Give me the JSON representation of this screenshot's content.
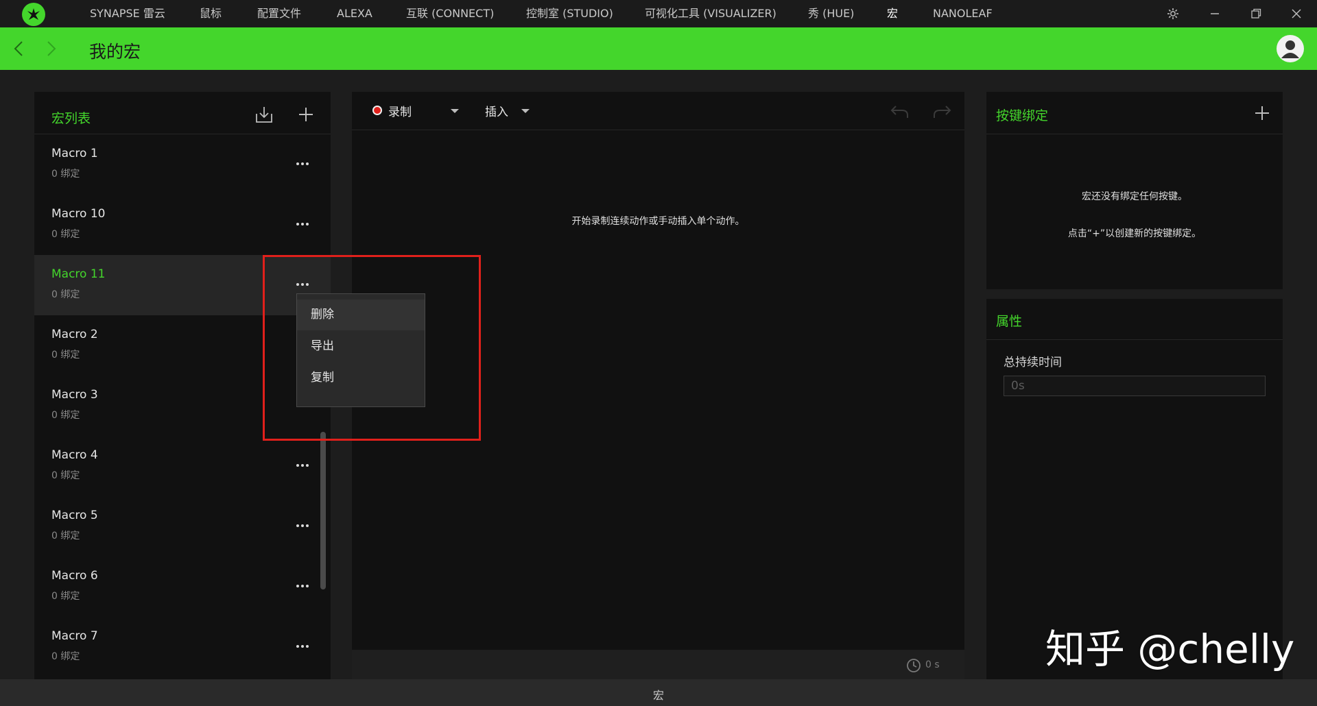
{
  "titlebar": {
    "nav": [
      "SYNAPSE 雷云",
      "鼠标",
      "配置文件",
      "ALEXA",
      "互联 (CONNECT)",
      "控制室 (STUDIO)",
      "可视化工具 (VISUALIZER)",
      "秀 (HUE)",
      "宏",
      "NANOLEAF"
    ],
    "active_index": 8
  },
  "header": {
    "title": "我的宏"
  },
  "macro_list": {
    "title": "宏列表",
    "items": [
      {
        "name": "Macro 1",
        "sub": "0 绑定"
      },
      {
        "name": "Macro 10",
        "sub": "0 绑定"
      },
      {
        "name": "Macro 11",
        "sub": "0 绑定"
      },
      {
        "name": "Macro 2",
        "sub": "0 绑定"
      },
      {
        "name": "Macro 3",
        "sub": "0 绑定"
      },
      {
        "name": "Macro 4",
        "sub": "0 绑定"
      },
      {
        "name": "Macro 5",
        "sub": "0 绑定"
      },
      {
        "name": "Macro 6",
        "sub": "0 绑定"
      },
      {
        "name": "Macro 7",
        "sub": "0 绑定"
      }
    ],
    "selected_index": 2
  },
  "context_menu": {
    "items": [
      "删除",
      "导出",
      "复制"
    ]
  },
  "editor": {
    "record_label": "录制",
    "insert_label": "插入",
    "empty_message": "开始录制连续动作或手动插入单个动作。",
    "duration": "0 s"
  },
  "key_binding": {
    "title": "按键绑定",
    "empty_line1": "宏还没有绑定任何按键。",
    "empty_line2": "点击“+”以创建新的按键绑定。"
  },
  "properties": {
    "title": "属性",
    "total_duration_label": "总持续时间",
    "total_duration_placeholder": "0s"
  },
  "statusbar": {
    "label": "宏"
  },
  "watermark": "知乎 @chelly",
  "colors": {
    "accent": "#44d62c",
    "highlight_box": "#e0201b",
    "record_dot": "#e0201b"
  }
}
